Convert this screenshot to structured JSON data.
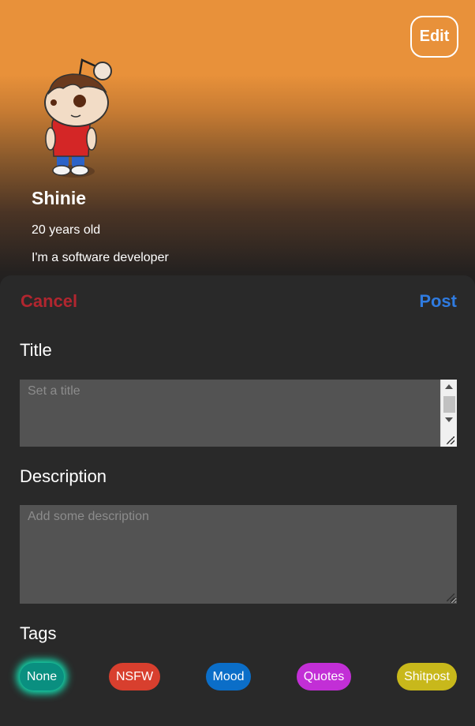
{
  "profile": {
    "edit_label": "Edit",
    "name": "Shinie",
    "age": "20 years old",
    "bio": "I'm a software developer"
  },
  "composer": {
    "cancel_label": "Cancel",
    "post_label": "Post",
    "title_label": "Title",
    "title_value": "",
    "title_placeholder": "Set a title",
    "description_label": "Description",
    "description_value": "",
    "description_placeholder": "Add some description",
    "tags_label": "Tags",
    "tags": [
      {
        "label": "None",
        "color": "#0a8f80",
        "selected": true
      },
      {
        "label": "NSFW",
        "color": "#d83f2e",
        "selected": false
      },
      {
        "label": "Mood",
        "color": "#0b6ec8",
        "selected": false
      },
      {
        "label": "Quotes",
        "color": "#c22fd6",
        "selected": false
      },
      {
        "label": "Shitpost",
        "color": "#c8b81b",
        "selected": false
      }
    ]
  },
  "colors": {
    "header_top": "#e8913a",
    "sheet_background": "#292929",
    "cancel": "#b1262f",
    "post": "#2f7be0",
    "selected_glow": "#12e5b6"
  },
  "icons": {
    "avatar": "cartoon-alien-avatar"
  }
}
